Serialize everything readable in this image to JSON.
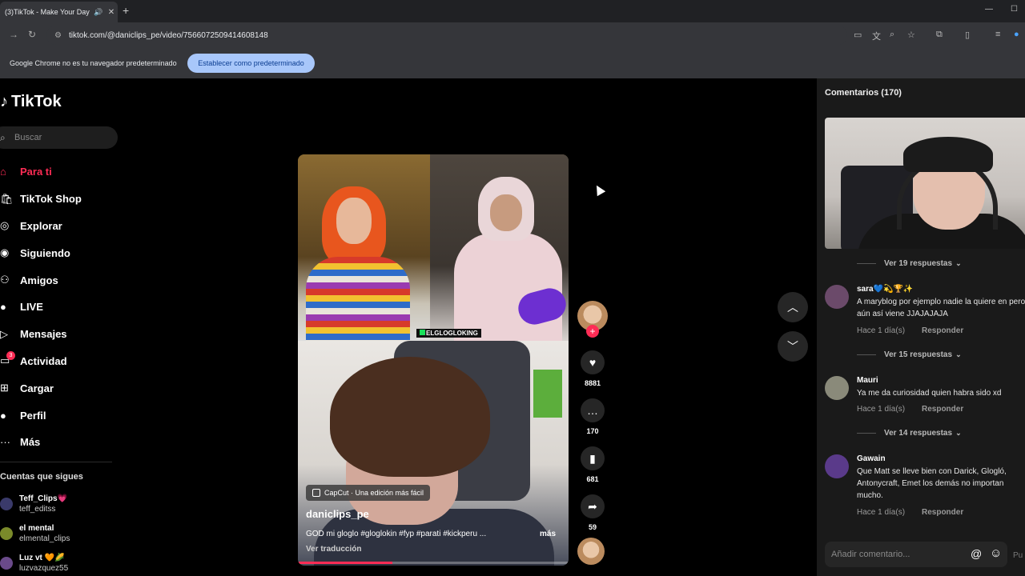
{
  "browser": {
    "tab_title": "(3)TikTok - Make Your Day",
    "url": "tiktok.com/@daniclips_pe/video/7566072509414608148",
    "infobar_message": "Google Chrome no es tu navegador predeterminado",
    "infobar_button": "Establecer como predeterminado"
  },
  "sidebar": {
    "logo_text": "TikTok",
    "search_placeholder": "Buscar",
    "nav": [
      {
        "label": "Para ti",
        "icon": "home-icon"
      },
      {
        "label": "TikTok Shop",
        "icon": "shop-icon"
      },
      {
        "label": "Explorar",
        "icon": "compass-icon"
      },
      {
        "label": "Siguiendo",
        "icon": "following-icon"
      },
      {
        "label": "Amigos",
        "icon": "friends-icon"
      },
      {
        "label": "LIVE",
        "icon": "live-icon"
      },
      {
        "label": "Mensajes",
        "icon": "send-icon"
      },
      {
        "label": "Actividad",
        "icon": "activity-icon",
        "badge": "3"
      },
      {
        "label": "Cargar",
        "icon": "upload-icon"
      },
      {
        "label": "Perfil",
        "icon": "profile-icon"
      },
      {
        "label": "Más",
        "icon": "more-icon"
      }
    ],
    "following_title": "Cuentas que sigues",
    "following": [
      {
        "name": "Teff_Clips💗",
        "handle": "teff_editss",
        "color": "#3a3a6a"
      },
      {
        "name": "el mental",
        "handle": "elmental_clips",
        "color": "#7a8a2a"
      },
      {
        "name": "Luz vt 🧡🌽",
        "handle": "luzvazquez55",
        "color": "#6a4a8a"
      }
    ]
  },
  "video": {
    "overlay_tag": "ELGLOGLOKING",
    "capcut_label": "CapCut · Una edición más fácil",
    "author": "daniclips_pe",
    "description": "GOD mi gloglo #gloglokin #fyp #parati #kickperu ...",
    "more_label": "más",
    "translate_label": "Ver traducción",
    "progress": 0.35
  },
  "actions": {
    "likes": "8881",
    "comments": "170",
    "saves": "681",
    "shares": "59"
  },
  "comments_panel": {
    "title": "Comentarios (170)",
    "input_placeholder": "Añadir comentario...",
    "post_label": "Pu",
    "items": [
      {
        "replies_label": "Ver 19 respuestas"
      },
      {
        "name": "sara💙💫🏆✨",
        "text": "A maryblog por ejemplo nadie la quiere en pero aún así viene JJAJAJAJA",
        "time": "Hace 1 día(s)",
        "reply": "Responder",
        "replies_label": "Ver 15 respuestas",
        "avatar_color": "#6b4a6a"
      },
      {
        "name": "Mauri",
        "text": "Ya me da curiosidad quien habra sido xd",
        "time": "Hace 1 día(s)",
        "reply": "Responder",
        "replies_label": "Ver 14 respuestas",
        "avatar_color": "#8a8a7a"
      },
      {
        "name": "Gawain",
        "text": "Que Matt se lleve bien con Darick, Glogló, Antonycraft, Emet los demás no importan mucho.",
        "time": "Hace 1 día(s)",
        "reply": "Responder",
        "avatar_color": "#5a3a8a"
      }
    ]
  }
}
